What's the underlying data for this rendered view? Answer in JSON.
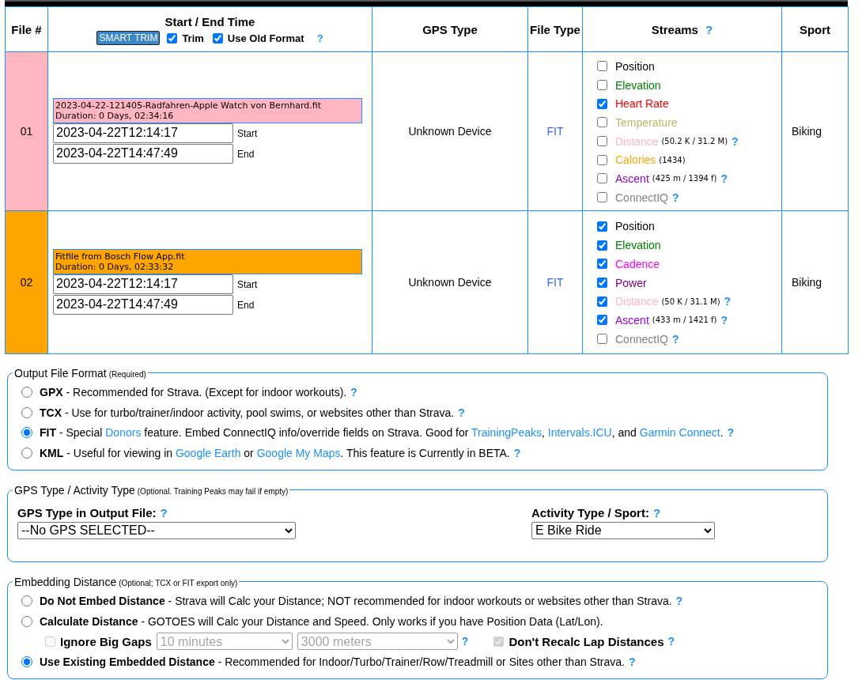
{
  "header": {
    "file_num": "File #",
    "time": "Start / End Time",
    "smart_trim": "SMART TRIM",
    "trim": {
      "label": "Trim",
      "checked": true
    },
    "old_format": {
      "label": "Use Old Format",
      "checked": true
    },
    "old_format_help": "?",
    "gps_type": "GPS Type",
    "file_type": "File Type",
    "streams": "Streams",
    "streams_help": "?",
    "sport": "Sport"
  },
  "files": [
    {
      "number": "01",
      "color": "#ffb6c1",
      "name": "2023-04-22-121405-Radfahren-Apple Watch von Bernhard.fit",
      "duration": "Duration: 0 Days, 02:34:16",
      "start": "2023-04-22T12:14:17",
      "start_label": "Start",
      "end": "2023-04-22T14:47:49",
      "end_label": "End",
      "gps_type": "Unknown Device",
      "file_type": "FIT",
      "sport": "Biking",
      "streams": [
        {
          "label": "Position",
          "color": "#000000",
          "checked": false
        },
        {
          "label": "Elevation",
          "color": "#008000",
          "checked": false
        },
        {
          "label": "Heart Rate",
          "color": "#ff0000",
          "checked": true
        },
        {
          "label": "Temperature",
          "color": "#bdb76b",
          "checked": false
        },
        {
          "label": "Distance",
          "color": "#ffb6c1",
          "checked": false,
          "detail": "(50.2 K / 31.2 M)",
          "help": "?"
        },
        {
          "label": "Calories",
          "color": "#ffa500",
          "checked": false,
          "detail": "(1434)"
        },
        {
          "label": "Ascent",
          "color": "#9400d3",
          "checked": false,
          "detail": "(425 m / 1394 f)",
          "help": "?"
        },
        {
          "label": "ConnectIQ",
          "color": "#808080",
          "checked": false,
          "help": "?"
        }
      ]
    },
    {
      "number": "02",
      "color": "#ffa500",
      "name": "Fitfile from Bosch Flow App.fit",
      "duration": "Duration: 0 Days, 02:33:32",
      "start": "2023-04-22T12:14:17",
      "start_label": "Start",
      "end": "2023-04-22T14:47:49",
      "end_label": "End",
      "gps_type": "Unknown Device",
      "file_type": "FIT",
      "sport": "Biking",
      "streams": [
        {
          "label": "Position",
          "color": "#000000",
          "checked": true
        },
        {
          "label": "Elevation",
          "color": "#008000",
          "checked": true
        },
        {
          "label": "Cadence",
          "color": "#ff00ff",
          "checked": true
        },
        {
          "label": "Power",
          "color": "#800080",
          "checked": true
        },
        {
          "label": "Distance",
          "color": "#ffb6c1",
          "checked": true,
          "detail": "(50 K / 31.1 M)",
          "help": "?"
        },
        {
          "label": "Ascent",
          "color": "#9400d3",
          "checked": true,
          "detail": "(433 m / 1421 f)",
          "help": "?"
        },
        {
          "label": "ConnectIQ",
          "color": "#808080",
          "checked": false,
          "help": "?"
        }
      ]
    }
  ],
  "output_format": {
    "legend": "Output File Format",
    "note": "(Required)",
    "options": [
      {
        "selected": false,
        "help": "?",
        "parts": [
          {
            "kind": "text",
            "text": "**GPX** - Recommended for Strava. (Except for indoor workouts)."
          }
        ]
      },
      {
        "selected": false,
        "help": "?",
        "parts": [
          {
            "kind": "text",
            "text": "**TCX** - Use for turbo/trainer/indoor activity, pool swims, or websites other than Strava."
          }
        ]
      },
      {
        "selected": true,
        "help": "?",
        "parts": [
          {
            "kind": "text",
            "text": "**FIT** - Special "
          },
          {
            "kind": "link",
            "text": "Donors"
          },
          {
            "kind": "text",
            "text": " feature. Embed ConnectIQ info/override fields on Strava. Good for "
          },
          {
            "kind": "link",
            "text": "TrainingPeaks"
          },
          {
            "kind": "text",
            "text": ", "
          },
          {
            "kind": "link",
            "text": "Intervals.ICU"
          },
          {
            "kind": "text",
            "text": ", and "
          },
          {
            "kind": "link",
            "text": "Garmin Connect"
          },
          {
            "kind": "text",
            "text": "."
          }
        ]
      },
      {
        "selected": false,
        "help": "?",
        "parts": [
          {
            "kind": "text",
            "text": "**KML** - Useful for viewing in "
          },
          {
            "kind": "link",
            "text": "Google Earth"
          },
          {
            "kind": "text",
            "text": " or "
          },
          {
            "kind": "link",
            "text": "Google My Maps"
          },
          {
            "kind": "text",
            "text": ". This feature is Currently in BETA."
          }
        ]
      }
    ]
  },
  "gps_activity": {
    "legend": "GPS Type / Activity Type",
    "note": "(Optional. Training Peaks may fail if empty)",
    "fields": [
      {
        "label": "GPS Type in Output File:",
        "help": "?",
        "value": "--No GPS SELECTED--"
      },
      {
        "label": "Activity Type / Sport:",
        "help": "?",
        "value": "E Bike Ride"
      }
    ]
  },
  "embedding": {
    "legend": "Embedding Distance",
    "note": "(Optional; TCX or FIT export only)",
    "options": [
      {
        "kind": "radio",
        "selected": false,
        "text": "**Do Not Embed Distance** - Strava will Calc your Distance; NOT recommended for indoor workouts or websites other than Strava.",
        "help": "?"
      },
      {
        "kind": "radio",
        "selected": false,
        "text": "**Calculate Distance** - GOTOES will Calc your Distance and Speed. Only works if you have Position Data (Lat/Lon)."
      },
      {
        "kind": "gaps",
        "checkbox": {
          "label": "Ignore Big Gaps",
          "checked": false,
          "disabled": true
        },
        "selects": [
          {
            "value": "10 minutes",
            "disabled": true
          },
          {
            "value": "3000 meters",
            "disabled": true
          }
        ],
        "help": "?",
        "lap": {
          "label": "Don't Recalc Lap Distances",
          "checked": true,
          "disabled": true
        },
        "lap_help": "?"
      },
      {
        "kind": "radio",
        "selected": true,
        "text": "**Use Existing Embedded Distance** - Recommended for Indoor/Turbo/Trainer/Row/Treadmill or Sites other than Strava.",
        "help": "?"
      }
    ]
  }
}
